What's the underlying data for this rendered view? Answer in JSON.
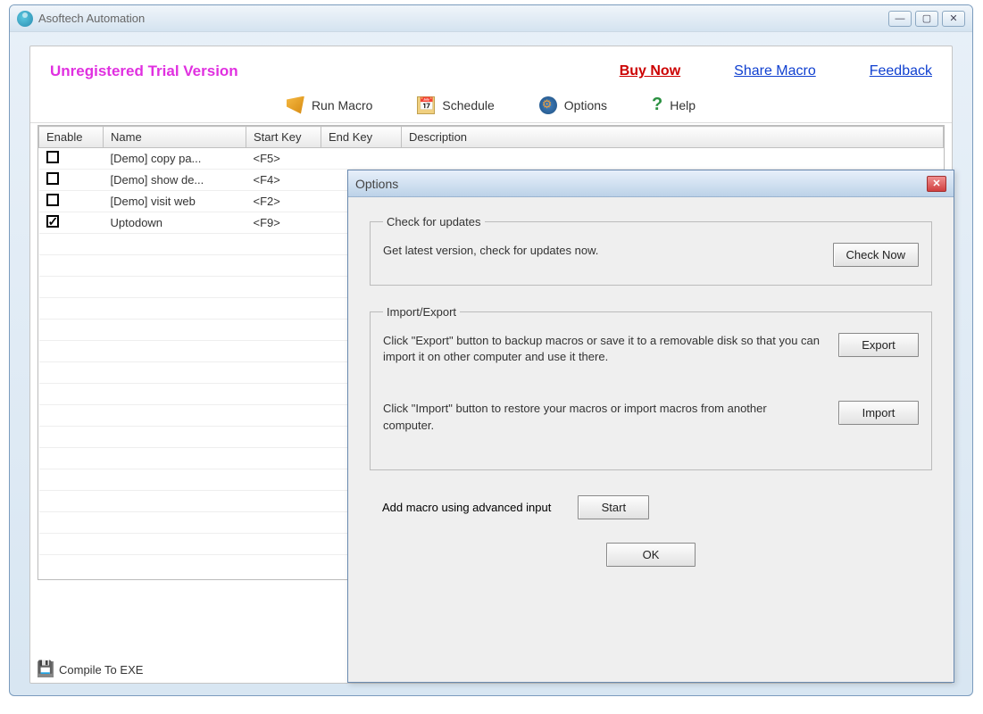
{
  "window": {
    "title": "Asoftech Automation"
  },
  "header": {
    "trial": "Unregistered Trial Version",
    "buy_now": "Buy Now",
    "share_macro": "Share Macro",
    "feedback": "Feedback"
  },
  "toolbar": {
    "run_macro": "Run Macro",
    "schedule": "Schedule",
    "options": "Options",
    "help": "Help"
  },
  "table": {
    "headers": {
      "enable": "Enable",
      "name": "Name",
      "start_key": "Start Key",
      "end_key": "End Key",
      "description": "Description"
    },
    "rows": [
      {
        "enabled": false,
        "name": "[Demo] copy pa...",
        "start_key": "<F5>"
      },
      {
        "enabled": false,
        "name": "[Demo] show de...",
        "start_key": "<F4>"
      },
      {
        "enabled": false,
        "name": "[Demo] visit web",
        "start_key": "<F2>"
      },
      {
        "enabled": true,
        "name": "Uptodown",
        "start_key": "<F9>"
      }
    ]
  },
  "footer": {
    "compile": "Compile To EXE"
  },
  "dialog": {
    "title": "Options",
    "updates": {
      "legend": "Check for updates",
      "text": "Get latest version, check for updates now.",
      "btn": "Check Now"
    },
    "import_export": {
      "legend": "Import/Export",
      "export_text": "Click \"Export\" button to backup macros or save it to a removable disk so that you can import it on other computer and use it there.",
      "export_btn": "Export",
      "import_text": "Click \"Import\" button to restore your macros or import macros from another computer.",
      "import_btn": "Import"
    },
    "advanced": {
      "label": "Add macro using advanced input",
      "start_btn": "Start"
    },
    "ok_btn": "OK"
  }
}
